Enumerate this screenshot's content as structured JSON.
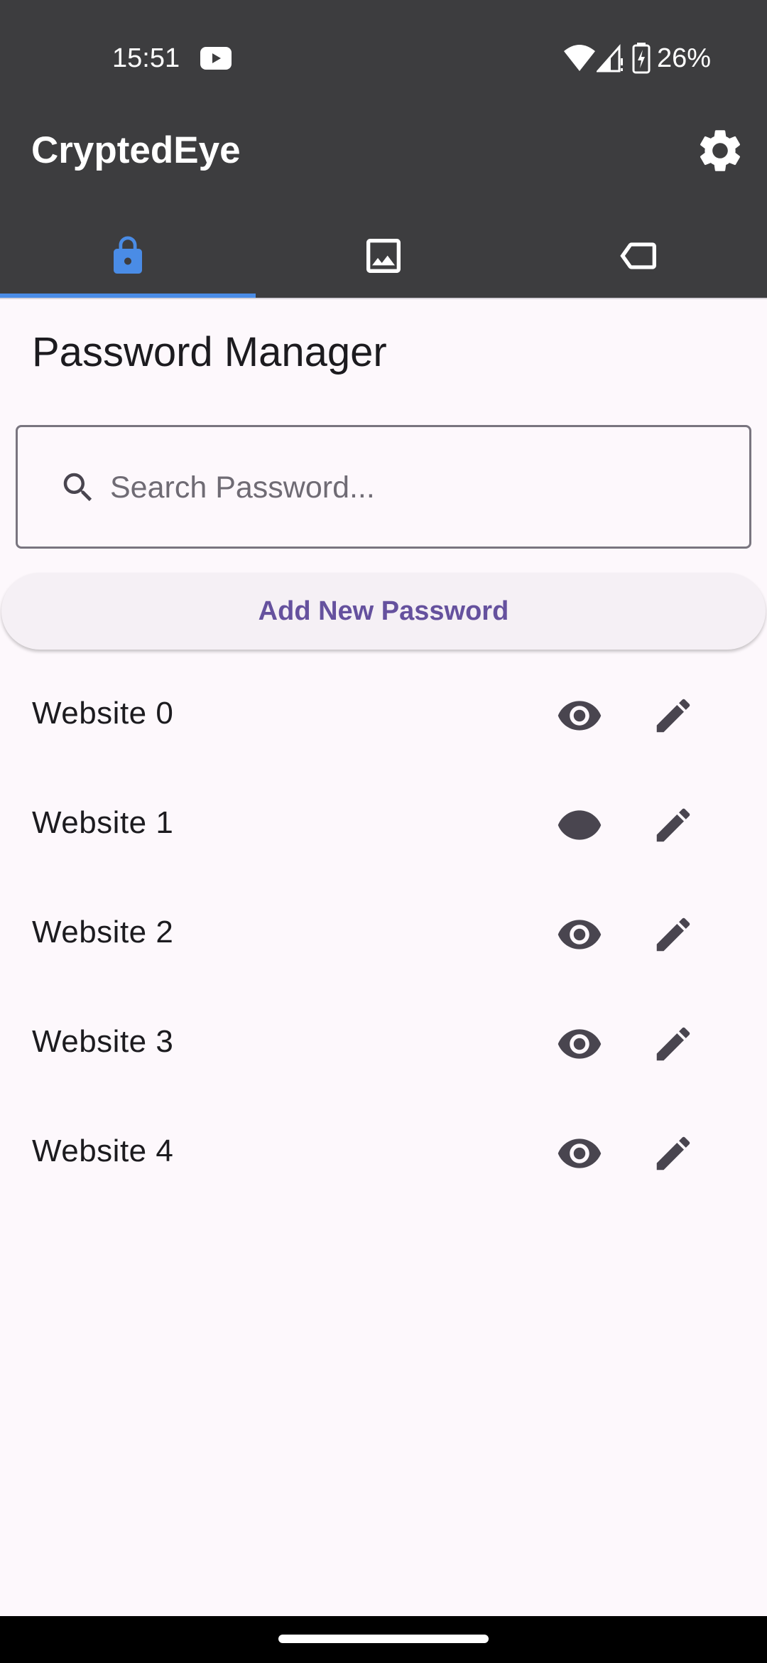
{
  "status_bar": {
    "time": "15:51",
    "battery": "26%",
    "icons": [
      "youtube-icon",
      "wifi-icon",
      "signal-icon",
      "battery-charging-icon"
    ]
  },
  "app_bar": {
    "title": "CryptedEye",
    "settings_icon": "gear-icon"
  },
  "tabs": [
    {
      "icon": "lock-icon",
      "selected": true
    },
    {
      "icon": "image-icon",
      "selected": false
    },
    {
      "icon": "label-icon",
      "selected": false
    }
  ],
  "main": {
    "title": "Password Manager",
    "search": {
      "placeholder": "Search Password...",
      "value": ""
    },
    "add_button_label": "Add New Password",
    "items": [
      {
        "label": "Website 0"
      },
      {
        "label": "Website 1"
      },
      {
        "label": "Website 2"
      },
      {
        "label": "Website 3"
      },
      {
        "label": "Website 4"
      }
    ]
  },
  "colors": {
    "app_bar": "#3D3D3F",
    "tab_accent": "#4A8CE6",
    "button_text": "#65519E",
    "background": "#FDF8FC",
    "icon": "#49454F"
  }
}
